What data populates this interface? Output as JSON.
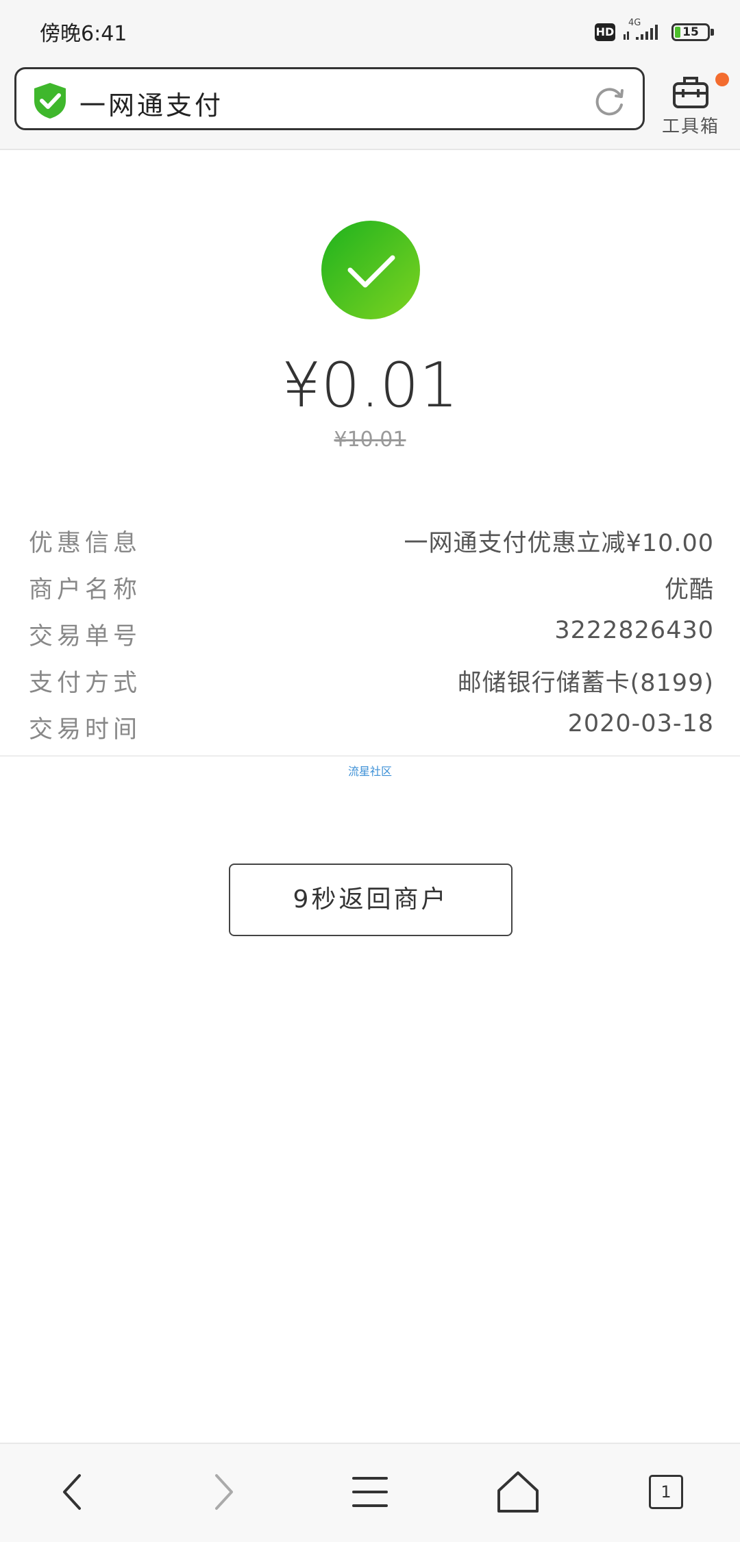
{
  "status_bar": {
    "time": "傍晚6:41",
    "hd_badge": "HD",
    "network": "4G",
    "battery": "15"
  },
  "topbar": {
    "title": "一网通支付",
    "toolbox_label": "工具箱"
  },
  "payment": {
    "amount": "¥0.01",
    "original_amount": "¥10.01"
  },
  "details": [
    {
      "label": "优惠信息",
      "value": "一网通支付优惠立减¥10.00"
    },
    {
      "label": "商户名称",
      "value": "优酷"
    },
    {
      "label": "交易单号",
      "value": "3222826430"
    },
    {
      "label": "支付方式",
      "value": "邮储银行储蓄卡(8199)"
    },
    {
      "label": "交易时间",
      "value": "2020-03-18"
    }
  ],
  "watermark": "流星社区",
  "return_button": "9秒返回商户",
  "bottom_nav": {
    "tab_count": "1"
  },
  "colors": {
    "success_green": "#2cb82a",
    "badge_orange": "#f36c2f",
    "watermark_blue": "#3b8fd6"
  }
}
